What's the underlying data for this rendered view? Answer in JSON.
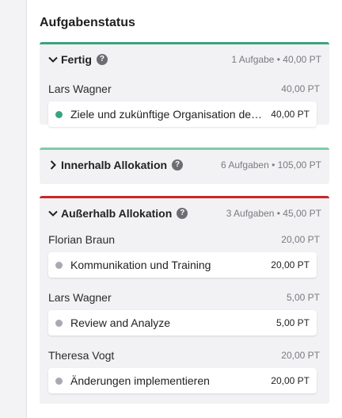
{
  "panel": {
    "title": "Aufgabenstatus"
  },
  "groups": [
    {
      "name": "Fertig",
      "summary": "1 Aufgabe • 40,00 PT",
      "accent": "#3aa37f",
      "expanded": true,
      "people": [
        {
          "name": "Lars Wagner",
          "points": "40,00 PT",
          "tasks": [
            {
              "title": "Ziele und zukünftige Organisation definieren",
              "points": "40,00 PT",
              "dot": "#3aa37f"
            }
          ]
        }
      ]
    },
    {
      "name": "Innerhalb Allokation",
      "summary": "6 Aufgaben • 105,00 PT",
      "accent": "#7fcca8",
      "expanded": false,
      "people": []
    },
    {
      "name": "Außerhalb Allokation",
      "summary": "3 Aufgaben • 45,00 PT",
      "accent": "#c62828",
      "expanded": true,
      "people": [
        {
          "name": "Florian Braun",
          "points": "20,00 PT",
          "tasks": [
            {
              "title": "Kommunikation und Training",
              "points": "20,00 PT",
              "dot": "#a9a9b3"
            }
          ]
        },
        {
          "name": "Lars Wagner",
          "points": "5,00 PT",
          "tasks": [
            {
              "title": "Review and Analyze",
              "points": "5,00 PT",
              "dot": "#a9a9b3"
            }
          ]
        },
        {
          "name": "Theresa Vogt",
          "points": "20,00 PT",
          "tasks": [
            {
              "title": "Änderungen implementieren",
              "points": "20,00 PT",
              "dot": "#a9a9b3"
            }
          ]
        }
      ]
    }
  ]
}
